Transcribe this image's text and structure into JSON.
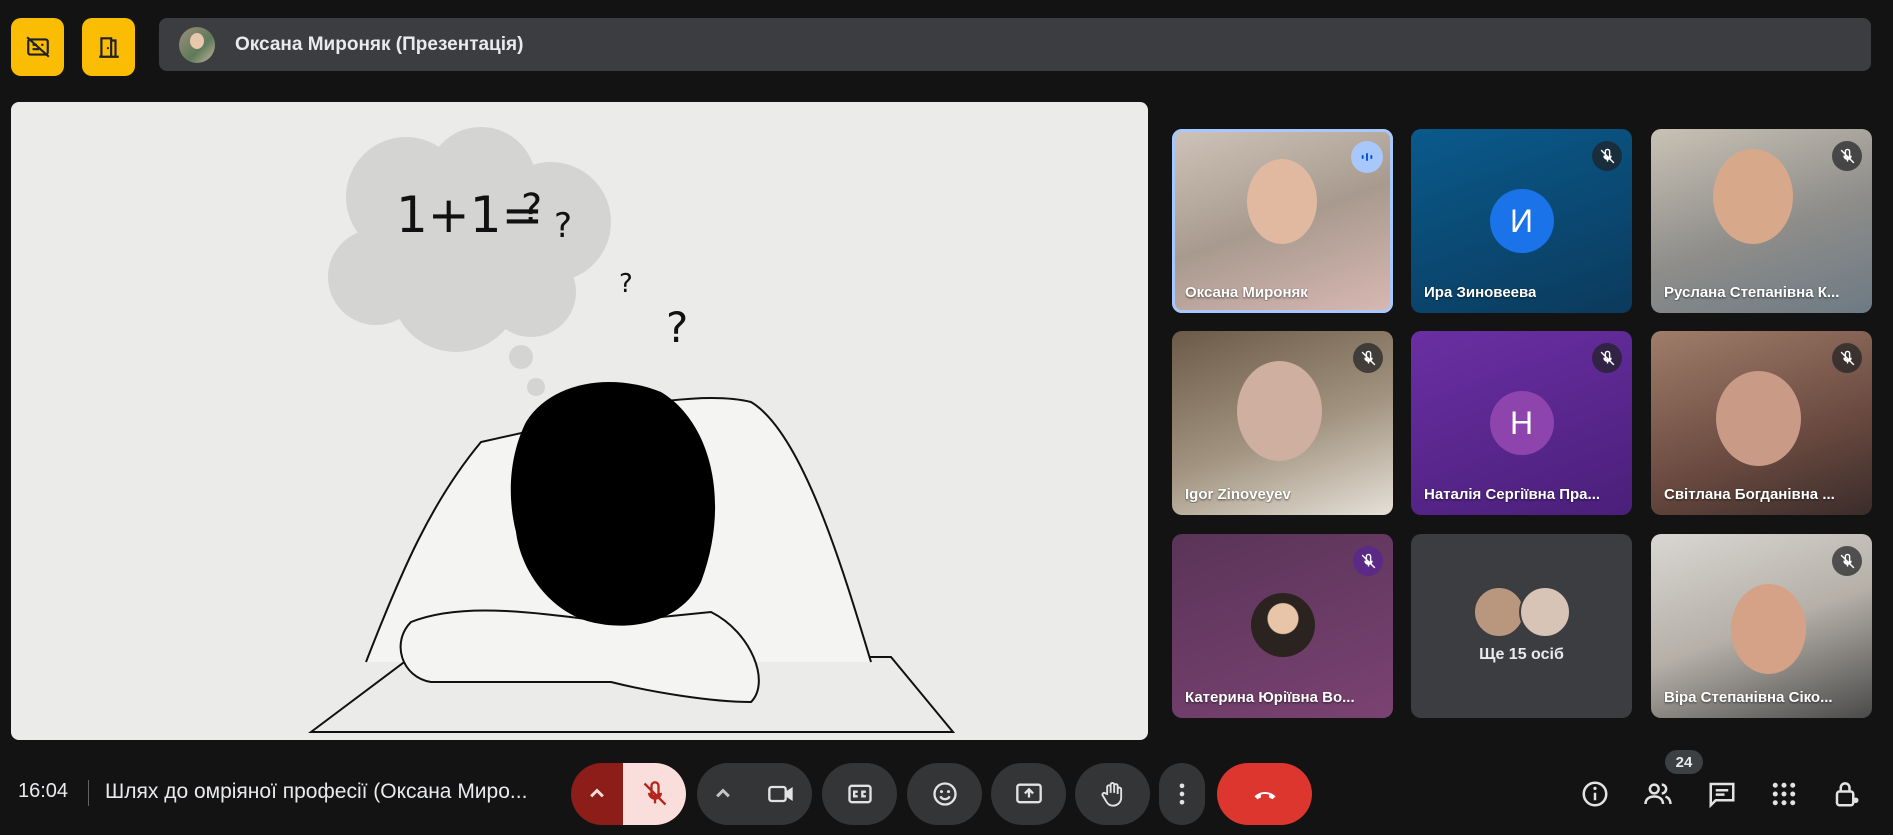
{
  "top": {
    "presenter_name": "Оксана Мироняк (Презентація)",
    "buttons": [
      {
        "icon": "closed-captions-off-icon"
      },
      {
        "icon": "exit-door-icon"
      }
    ],
    "accent": "#fbbc04"
  },
  "stage": {
    "slide_equation": "1+1=",
    "question_marks": [
      "?",
      "?",
      "?",
      "?"
    ]
  },
  "participants": [
    {
      "name": "Оксана Мироняк",
      "state": "speaking",
      "bg": "video"
    },
    {
      "name": "Ира Зиновеева",
      "state": "muted",
      "avatar_letter": "И",
      "avatar_color": "#1a73e8",
      "bg": "#0f4c75"
    },
    {
      "name": "Руслана Степанівна К...",
      "state": "muted",
      "bg": "video"
    },
    {
      "name": "Igor Zinoveyev",
      "state": "muted",
      "bg": "video"
    },
    {
      "name": "Наталія Сергіївна Пра...",
      "state": "muted",
      "avatar_letter": "Н",
      "avatar_color": "#8e44ad",
      "bg": "#5b2a86"
    },
    {
      "name": "Світлана Богданівна ...",
      "state": "muted",
      "bg": "video"
    },
    {
      "name": "Катерина Юріївна Во...",
      "state": "muted",
      "bg": "#6b3a63"
    },
    {
      "name": "",
      "state": "more",
      "more_label": "Ще 15 осіб"
    },
    {
      "name": "Віра Степанівна Сіко...",
      "state": "muted",
      "bg": "video"
    }
  ],
  "bottom": {
    "time": "16:04",
    "meeting_title": "Шлях до омріяної професії (Оксана Миро...",
    "people_count": "24",
    "hangup_color": "#ea4335",
    "mic_off_color": "#f9dedc"
  }
}
